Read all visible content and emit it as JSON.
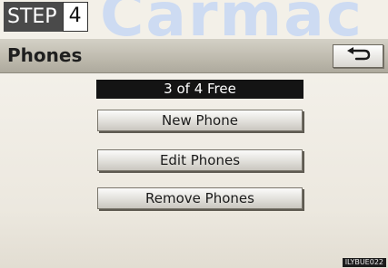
{
  "watermark": "Carmac",
  "step": {
    "label": "STEP",
    "number": "4"
  },
  "header": {
    "title": "Phones",
    "back_icon": "back-arrow-icon"
  },
  "status": {
    "free_text": "3 of 4 Free"
  },
  "buttons": {
    "new_phone": "New Phone",
    "edit_phones": "Edit Phones",
    "remove_phones": "Remove Phones"
  },
  "figure_code": "ILYBUE022",
  "colors": {
    "title_bar": "#bdb9ad",
    "status_bar": "#141414",
    "watermark": "#c7d8f4"
  }
}
